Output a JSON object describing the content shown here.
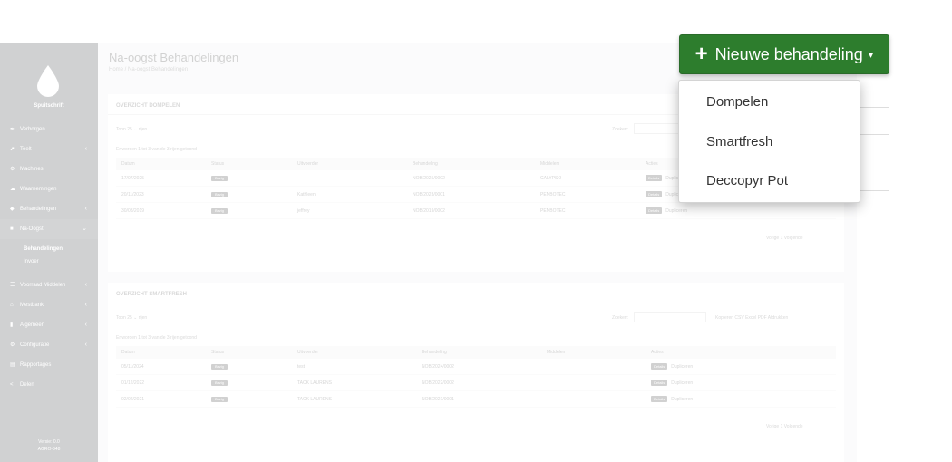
{
  "sidebar": {
    "app_name": "Spuitschrift",
    "items": [
      {
        "icon": "✒",
        "label": "Verborgen",
        "chevron": ""
      },
      {
        "icon": "⬈",
        "label": "Teelt",
        "chevron": "‹"
      },
      {
        "icon": "⚙",
        "label": "Machines",
        "chevron": ""
      },
      {
        "icon": "☁",
        "label": "Waarnemingen",
        "chevron": ""
      },
      {
        "icon": "◆",
        "label": "Behandelingen",
        "chevron": "‹"
      },
      {
        "icon": "■",
        "label": "Na-Oogst",
        "chevron": "⌄"
      }
    ],
    "sub_items": [
      "Behandelingen",
      "Invoer"
    ],
    "items2": [
      {
        "icon": "☰",
        "label": "Voorraad Middelen",
        "chevron": "‹"
      },
      {
        "icon": "⌂",
        "label": "Mestbank",
        "chevron": "‹"
      },
      {
        "icon": "▮",
        "label": "Algemeen",
        "chevron": "‹"
      },
      {
        "icon": "⚙",
        "label": "Configuratie",
        "chevron": "‹"
      },
      {
        "icon": "▤",
        "label": "Rapportages",
        "chevron": ""
      },
      {
        "icon": "<",
        "label": "Delen",
        "chevron": ""
      }
    ],
    "version_line1": "Versie: 0.0",
    "version_line2": "AGRO-348"
  },
  "page": {
    "title": "Na-oogst Behandelingen",
    "breadcrumb": "Home / Na-oogst Behandelingen"
  },
  "dompelen": {
    "title": "OVERZICHT DOMPELEN",
    "show_text": "Toon  25  ⌄  rijen",
    "search_label": "Zoeken:",
    "info": "Er worden 1 tot 3 van de 3 rijen getoond",
    "headers": [
      "Datum",
      "Status",
      "Uitvoerder",
      "Behandeling",
      "Middelen",
      "Acties"
    ],
    "rows": [
      {
        "datum": "17/07/2025",
        "status": "Bezig",
        "uitvoerder": "",
        "behandeling": "NOB/2025/0002",
        "middelen": "CALYPSO"
      },
      {
        "datum": "20/11/2023",
        "status": "Bezig",
        "uitvoerder": "Kathleen",
        "behandeling": "NOB/2023/0001",
        "middelen": "PENBOTEC"
      },
      {
        "datum": "30/08/2019",
        "status": "Bezig",
        "uitvoerder": "jeffrey",
        "behandeling": "NOB/2019/0002",
        "middelen": "PENBOTEC"
      }
    ],
    "detail_label": "Details",
    "dup_label": "Dupliceren",
    "pager": "Vorige   1   Volgende"
  },
  "smartfresh": {
    "title": "OVERZICHT SMARTFRESH",
    "show_text": "Toon  25  ⌄  rijen",
    "search_label": "Zoeken:",
    "export_buttons": "Kopieren   CSV   Excel   PDF   Afdrukken",
    "info": "Er worden 1 tot 3 van de 3 rijen getoond",
    "headers": [
      "Datum",
      "Status",
      "Uitvoerder",
      "Behandeling",
      "Middelen",
      "Acties"
    ],
    "rows": [
      {
        "datum": "05/11/2024",
        "status": "Bezig",
        "uitvoerder": "test",
        "behandeling": "NOB/2024/0002",
        "middelen": ""
      },
      {
        "datum": "01/12/2022",
        "status": "Bezig",
        "uitvoerder": "TACK LAURENS",
        "behandeling": "NOB/2022/0002",
        "middelen": ""
      },
      {
        "datum": "02/02/2021",
        "status": "Bezig",
        "uitvoerder": "TACK LAURENS",
        "behandeling": "NOB/2021/0001",
        "middelen": ""
      }
    ],
    "detail_label": "Details",
    "dup_label": "Dupliceren",
    "pager": "Vorige   1   Volgende"
  },
  "new_button": {
    "label": "Nieuwe behandeling",
    "plus": "+",
    "caret": "▾"
  },
  "dropdown": {
    "items": [
      "Dompelen",
      "Smartfresh",
      "Deccopyr Pot"
    ]
  },
  "colors": {
    "button_green": "#2d7d2d",
    "sidebar_dark": "#2f3439"
  }
}
